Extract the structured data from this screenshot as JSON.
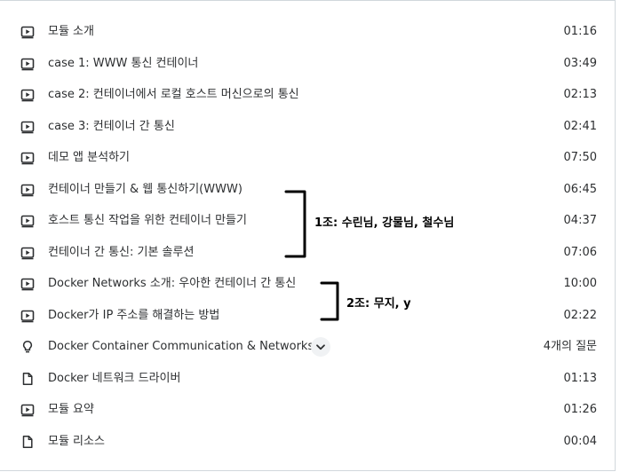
{
  "lectures": [
    {
      "icon": "play-video-icon",
      "title": "모듈 소개",
      "duration": "01:16"
    },
    {
      "icon": "play-video-icon",
      "title": "case 1: WWW 통신 컨테이너",
      "duration": "03:49"
    },
    {
      "icon": "play-video-icon",
      "title": "case 2: 컨테이너에서 로컬 호스트 머신으로의 통신",
      "duration": "02:13"
    },
    {
      "icon": "play-video-icon",
      "title": "case 3: 컨테이너 간 통신",
      "duration": "02:41"
    },
    {
      "icon": "play-video-icon",
      "title": "데모 앱 분석하기",
      "duration": "07:50"
    },
    {
      "icon": "play-video-icon",
      "title": "컨테이너 만들기 & 웹 통신하기(WWW)",
      "duration": "06:45"
    },
    {
      "icon": "play-video-icon",
      "title": "호스트 통신 작업을 위한 컨테이너 만들기",
      "duration": "04:37"
    },
    {
      "icon": "play-video-icon",
      "title": "컨테이너 간 통신: 기본 솔루션",
      "duration": "07:06"
    },
    {
      "icon": "play-video-icon",
      "title": "Docker Networks 소개: 우아한 컨테이너 간 통신",
      "duration": "10:00"
    },
    {
      "icon": "play-video-icon",
      "title": "Docker가 IP 주소를 해결하는 방법",
      "duration": "02:22"
    },
    {
      "icon": "lightbulb-icon",
      "title": "Docker Container Communication & Networks",
      "duration": "4개의 질문",
      "expandable": true
    },
    {
      "icon": "document-icon",
      "title": "Docker 네트워크 드라이버",
      "duration": "01:13"
    },
    {
      "icon": "play-video-icon",
      "title": "모듈 요약",
      "duration": "01:26"
    },
    {
      "icon": "document-icon",
      "title": "모듈 리소스",
      "duration": "00:04"
    }
  ],
  "annotations": {
    "group1": "1조: 수린님, 강물님, 철수님",
    "group2": "2조: 무지, y"
  }
}
